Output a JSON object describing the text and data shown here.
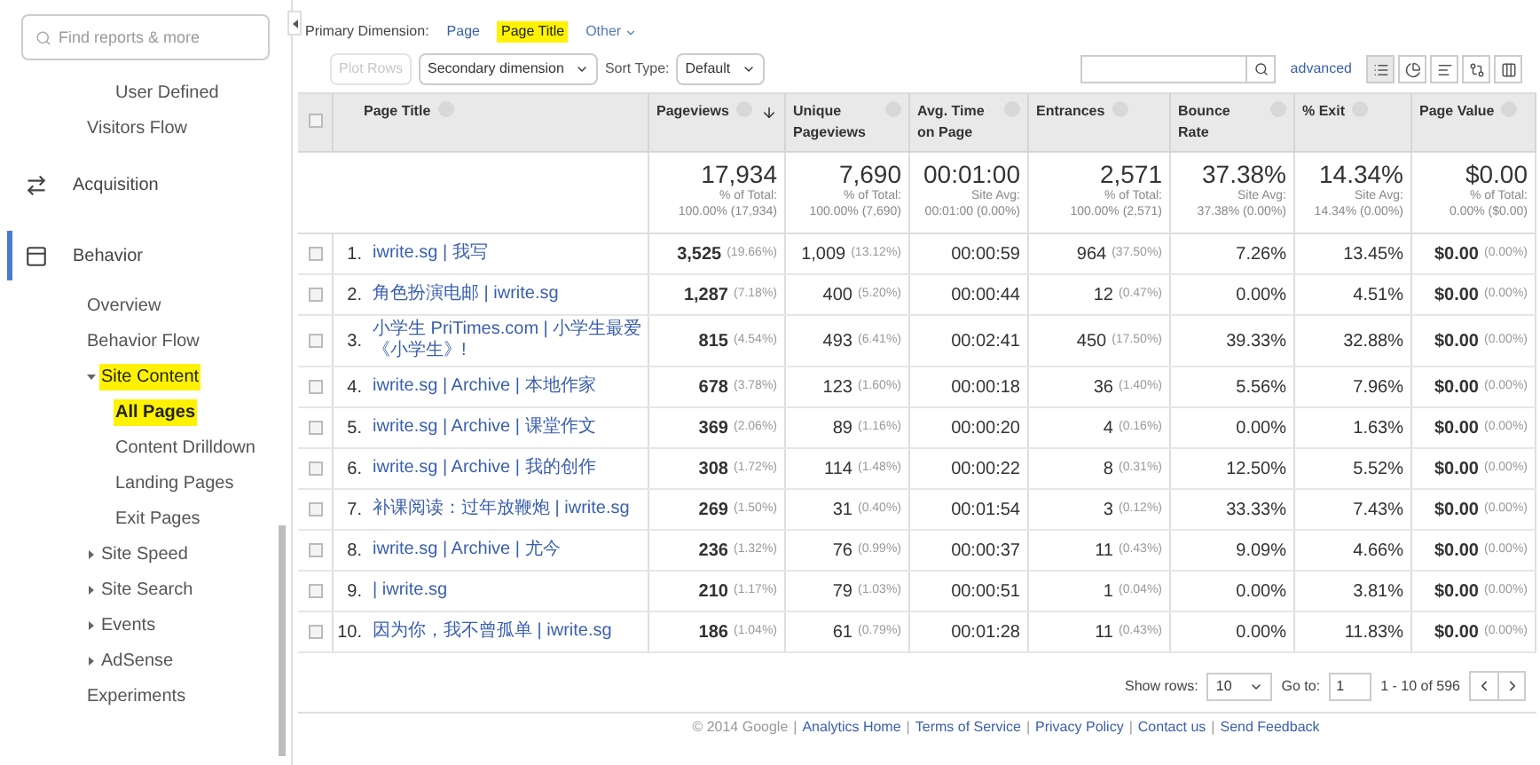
{
  "sidebar": {
    "search": {
      "placeholder": "Find reports & more"
    },
    "sections": [
      {
        "items": [
          {
            "children": [
              {
                "label": "User Defined",
                "selected": false
              }
            ]
          },
          {
            "label": "Visitors Flow",
            "selected": false
          }
        ]
      },
      {
        "label": "Acquisition",
        "selected": false
      },
      {
        "label": "Behavior",
        "selected": true,
        "items": [
          {
            "label": "Overview",
            "selected": false
          },
          {
            "label": "Behavior Flow",
            "selected": false
          },
          {
            "label": "Site Content",
            "selected": true,
            "expanded": true,
            "children": [
              {
                "label": "All Pages",
                "selected": true
              },
              {
                "label": "Content Drilldown",
                "selected": false
              },
              {
                "label": "Landing Pages",
                "selected": false
              },
              {
                "label": "Exit Pages",
                "selected": false
              }
            ]
          },
          {
            "label": "Site Speed",
            "selected": false,
            "expanded": false
          },
          {
            "label": "Site Search",
            "selected": false,
            "expanded": false
          },
          {
            "label": "Events",
            "selected": false,
            "expanded": false
          },
          {
            "label": "AdSense",
            "selected": false,
            "expanded": false
          },
          {
            "label": "Experiments",
            "selected": false
          }
        ]
      }
    ]
  },
  "primary_dimension": {
    "label": "Primary Dimension:",
    "options": [
      {
        "label": "Page",
        "selected": false
      },
      {
        "label": "Page Title",
        "selected": true
      }
    ],
    "other": "Other"
  },
  "toolbar": {
    "plot_rows": {
      "label": "Plot Rows",
      "disabled": true
    },
    "secondary_dimension": "Secondary dimension",
    "sort_type_label": "Sort Type:",
    "sort_type": "Default",
    "advanced": "advanced"
  },
  "table": {
    "select_all": {
      "checked": false
    },
    "columns": [
      {
        "label": "Page Title",
        "sorted": false
      },
      {
        "label": "Pageviews",
        "sorted": true
      },
      {
        "label": "Unique Pageviews",
        "sorted": false
      },
      {
        "label": "Avg. Time on Page",
        "sorted": false
      },
      {
        "label": "Entrances",
        "sorted": false
      },
      {
        "label": "Bounce Rate",
        "sorted": false
      },
      {
        "label": "% Exit",
        "sorted": false
      },
      {
        "label": "Page Value",
        "sorted": false
      }
    ],
    "totals": [
      {
        "value": "17,934",
        "note": "% of Total:",
        "detail": "100.00% (17,934)"
      },
      {
        "value": "7,690",
        "note": "% of Total:",
        "detail": "100.00% (7,690)"
      },
      {
        "value": "00:01:00",
        "note": "Site Avg:",
        "detail": "00:01:00 (0.00%)"
      },
      {
        "value": "2,571",
        "note": "% of Total:",
        "detail": "100.00% (2,571)"
      },
      {
        "value": "37.38%",
        "note": "Site Avg:",
        "detail": "37.38% (0.00%)"
      },
      {
        "value": "14.34%",
        "note": "Site Avg:",
        "detail": "14.34% (0.00%)"
      },
      {
        "value": "$0.00",
        "note": "% of Total:",
        "detail": "0.00% ($0.00)"
      }
    ],
    "rows": [
      {
        "number": "1.",
        "title": "iwrite.sg | 我写",
        "checked": false,
        "cells": [
          {
            "value": "3,525",
            "share": "(19.66%)"
          },
          {
            "value": "1,009",
            "share": "(13.12%)"
          },
          {
            "value": "00:00:59"
          },
          {
            "value": "964",
            "share": "(37.50%)"
          },
          {
            "value": "7.26%"
          },
          {
            "value": "13.45%"
          },
          {
            "value": "$0.00",
            "share": "(0.00%)"
          }
        ]
      },
      {
        "number": "2.",
        "title": "角色扮演电邮 | iwrite.sg",
        "checked": false,
        "cells": [
          {
            "value": "1,287",
            "share": "(7.18%)"
          },
          {
            "value": "400",
            "share": "(5.20%)"
          },
          {
            "value": "00:00:44"
          },
          {
            "value": "12",
            "share": "(0.47%)"
          },
          {
            "value": "0.00%"
          },
          {
            "value": "4.51%"
          },
          {
            "value": "$0.00",
            "share": "(0.00%)"
          }
        ]
      },
      {
        "number": "3.",
        "title": "小学生 PriTimes.com | 小学生最爱《小学生》!",
        "checked": false,
        "cells": [
          {
            "value": "815",
            "share": "(4.54%)"
          },
          {
            "value": "493",
            "share": "(6.41%)"
          },
          {
            "value": "00:02:41"
          },
          {
            "value": "450",
            "share": "(17.50%)"
          },
          {
            "value": "39.33%"
          },
          {
            "value": "32.88%"
          },
          {
            "value": "$0.00",
            "share": "(0.00%)"
          }
        ]
      },
      {
        "number": "4.",
        "title": "iwrite.sg | Archive | 本地作家",
        "checked": false,
        "cells": [
          {
            "value": "678",
            "share": "(3.78%)"
          },
          {
            "value": "123",
            "share": "(1.60%)"
          },
          {
            "value": "00:00:18"
          },
          {
            "value": "36",
            "share": "(1.40%)"
          },
          {
            "value": "5.56%"
          },
          {
            "value": "7.96%"
          },
          {
            "value": "$0.00",
            "share": "(0.00%)"
          }
        ]
      },
      {
        "number": "5.",
        "title": "iwrite.sg | Archive | 课堂作文",
        "checked": false,
        "cells": [
          {
            "value": "369",
            "share": "(2.06%)"
          },
          {
            "value": "89",
            "share": "(1.16%)"
          },
          {
            "value": "00:00:20"
          },
          {
            "value": "4",
            "share": "(0.16%)"
          },
          {
            "value": "0.00%"
          },
          {
            "value": "1.63%"
          },
          {
            "value": "$0.00",
            "share": "(0.00%)"
          }
        ]
      },
      {
        "number": "6.",
        "title": "iwrite.sg | Archive | 我的创作",
        "checked": false,
        "cells": [
          {
            "value": "308",
            "share": "(1.72%)"
          },
          {
            "value": "114",
            "share": "(1.48%)"
          },
          {
            "value": "00:00:22"
          },
          {
            "value": "8",
            "share": "(0.31%)"
          },
          {
            "value": "12.50%"
          },
          {
            "value": "5.52%"
          },
          {
            "value": "$0.00",
            "share": "(0.00%)"
          }
        ]
      },
      {
        "number": "7.",
        "title": "补课阅读：过年放鞭炮 | iwrite.sg",
        "checked": false,
        "cells": [
          {
            "value": "269",
            "share": "(1.50%)"
          },
          {
            "value": "31",
            "share": "(0.40%)"
          },
          {
            "value": "00:01:54"
          },
          {
            "value": "3",
            "share": "(0.12%)"
          },
          {
            "value": "33.33%"
          },
          {
            "value": "7.43%"
          },
          {
            "value": "$0.00",
            "share": "(0.00%)"
          }
        ]
      },
      {
        "number": "8.",
        "title": "iwrite.sg | Archive | 尤今",
        "checked": false,
        "cells": [
          {
            "value": "236",
            "share": "(1.32%)"
          },
          {
            "value": "76",
            "share": "(0.99%)"
          },
          {
            "value": "00:00:37"
          },
          {
            "value": "11",
            "share": "(0.43%)"
          },
          {
            "value": "9.09%"
          },
          {
            "value": "4.66%"
          },
          {
            "value": "$0.00",
            "share": "(0.00%)"
          }
        ]
      },
      {
        "number": "9.",
        "title": "| iwrite.sg",
        "checked": false,
        "cells": [
          {
            "value": "210",
            "share": "(1.17%)"
          },
          {
            "value": "79",
            "share": "(1.03%)"
          },
          {
            "value": "00:00:51"
          },
          {
            "value": "1",
            "share": "(0.04%)"
          },
          {
            "value": "0.00%"
          },
          {
            "value": "3.81%"
          },
          {
            "value": "$0.00",
            "share": "(0.00%)"
          }
        ]
      },
      {
        "number": "10.",
        "title": "因为你，我不曾孤单 | iwrite.sg",
        "checked": false,
        "cells": [
          {
            "value": "186",
            "share": "(1.04%)"
          },
          {
            "value": "61",
            "share": "(0.79%)"
          },
          {
            "value": "00:01:28"
          },
          {
            "value": "11",
            "share": "(0.43%)"
          },
          {
            "value": "0.00%"
          },
          {
            "value": "11.83%"
          },
          {
            "value": "$0.00",
            "share": "(0.00%)"
          }
        ]
      }
    ]
  },
  "pagination": {
    "show_rows_label": "Show rows:",
    "show_rows": "10",
    "go_to_label": "Go to:",
    "go_to": "1",
    "range": "1 - 10 of 596"
  },
  "footer": {
    "copyright": "© 2014 Google",
    "separator": "|",
    "links": [
      "Analytics Home",
      "Terms of Service",
      "Privacy Policy",
      "Contact us",
      "Send Feedback"
    ]
  }
}
